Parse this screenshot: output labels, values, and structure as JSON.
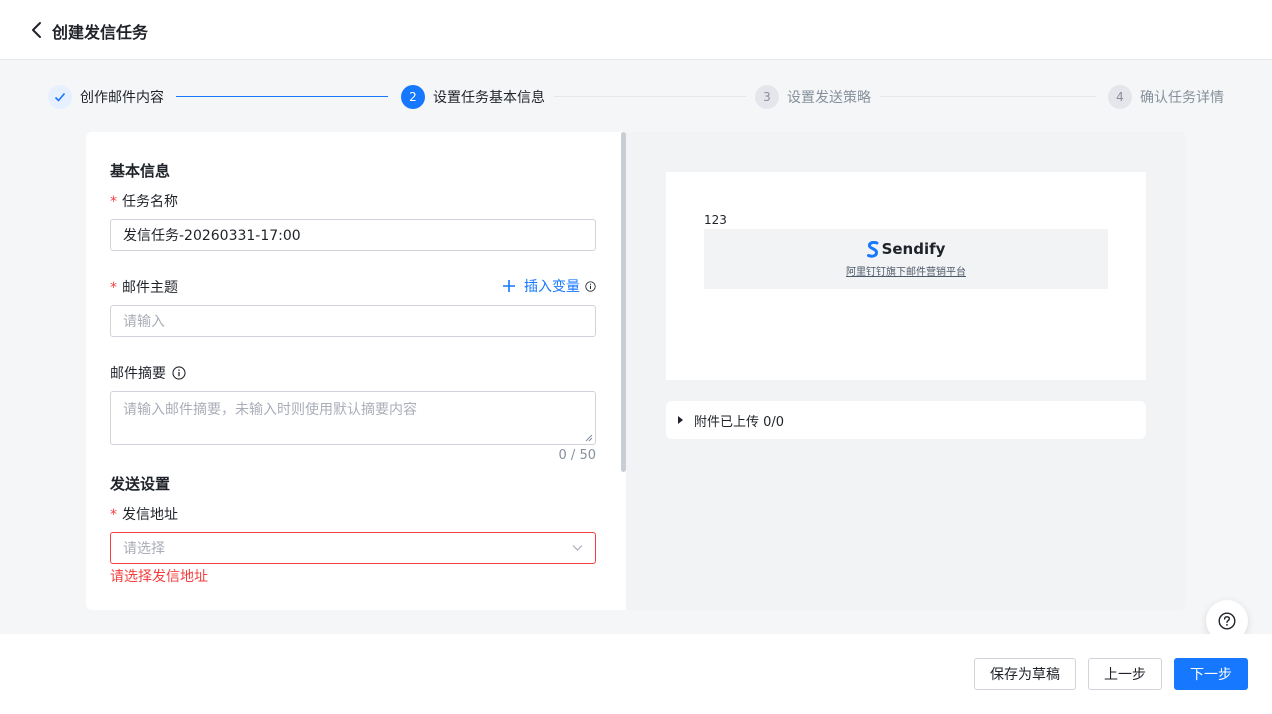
{
  "header": {
    "title": "创建发信任务"
  },
  "steps": [
    {
      "index": "1",
      "label": "创作邮件内容",
      "state": "done"
    },
    {
      "index": "2",
      "label": "设置任务基本信息",
      "state": "active"
    },
    {
      "index": "3",
      "label": "设置发送策略",
      "state": "todo"
    },
    {
      "index": "4",
      "label": "确认任务详情",
      "state": "todo"
    }
  ],
  "form": {
    "basic_title": "基本信息",
    "task_name": {
      "label": "任务名称",
      "value": "发信任务-20260331-17:00"
    },
    "subject": {
      "label": "邮件主题",
      "placeholder": "请输入",
      "insert_label": "插入变量"
    },
    "summary": {
      "label": "邮件摘要",
      "placeholder": "请输入邮件摘要，未输入时则使用默认摘要内容",
      "counter": "0 / 50"
    },
    "send_title": "发送设置",
    "sender": {
      "label": "发信地址",
      "placeholder": "请选择",
      "error": "请选择发信地址"
    }
  },
  "preview": {
    "body_text": "123",
    "brand_name": "Sendify",
    "brand_tagline": "阿里钉钉旗下邮件营销平台",
    "attachments": "附件已上传 0/0"
  },
  "footer": {
    "save_draft": "保存为草稿",
    "prev": "上一步",
    "next": "下一步"
  },
  "colors": {
    "primary": "#1677ff",
    "error": "#f53f3f"
  },
  "icons": [
    "back-icon",
    "check-icon",
    "plus-icon",
    "info-icon",
    "chevron-down-icon",
    "caret-right-icon",
    "help-icon"
  ]
}
